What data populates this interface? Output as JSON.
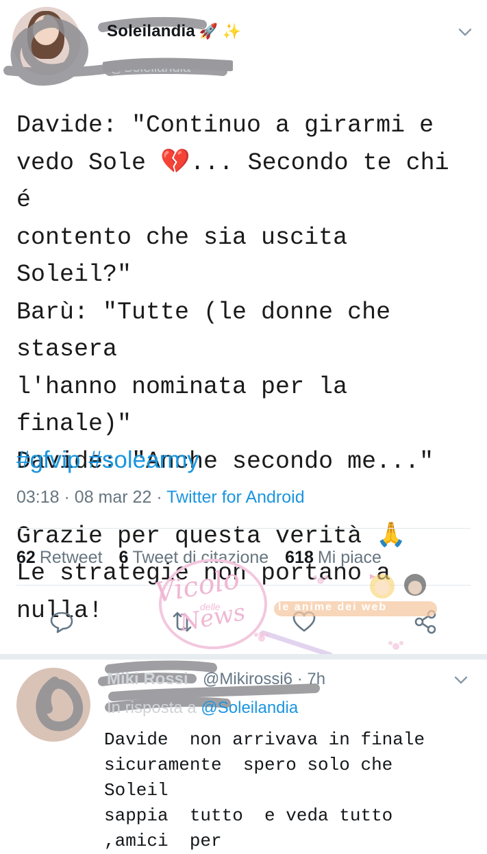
{
  "tweet": {
    "author_name": "Soleilandia",
    "author_emoji": "🚀 ✨",
    "author_handle": "@Soleilandia",
    "text": "Davide: \"Continuo a girarmi e\nvedo Sole 💔... Secondo te chi é\ncontento che sia uscita Soleil?\"\nBarù: \"Tutte (le donne che stasera\nl'hanno nominata per la finale)\"\nDavide: \"Anche secondo me...\"\n\nGrazie per questa verità 🙏\nLe strategie non portano a nulla!",
    "hashtags": [
      "#gfvip",
      "#solearmy"
    ],
    "time": "03:18",
    "date": "08 mar 22",
    "client": "Twitter for Android",
    "separator": "·"
  },
  "stats": {
    "retweets_count": "62",
    "retweets_label": "Retweet",
    "quotes_count": "6",
    "quotes_label": "Tweet di citazione",
    "likes_count": "618",
    "likes_label": "Mi piace"
  },
  "actions": [
    "reply-icon",
    "retweet-icon",
    "like-icon",
    "share-icon"
  ],
  "watermark": {
    "script_text": "Vicolo",
    "small_text": "delle",
    "script_text_2": "News",
    "bar_text": "le anime dei web"
  },
  "reply": {
    "author_name": "Miki Rossi",
    "author_handle": "@Mikirossi6 · 7h",
    "in_reply_prefix": "In risposta a",
    "in_reply_mention": "@Soleilandia",
    "text": "Davide  non arrivava in finale\nsicuramente  spero solo che Soleil\nsappia  tutto  e veda tutto  ,amici  per"
  },
  "colors": {
    "link": "#1b95e0",
    "secondary": "#66757f",
    "divider": "#e1e8ed",
    "watermark_pink": "#f0b7d4"
  }
}
